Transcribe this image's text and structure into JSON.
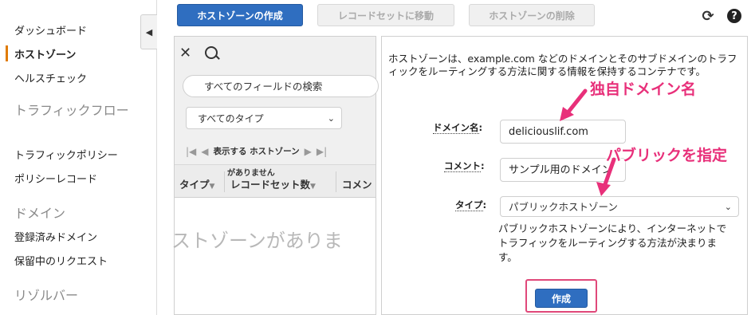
{
  "sidebar": {
    "items": [
      {
        "label": "ダッシュボード",
        "active": false
      },
      {
        "label": "ホストゾーン",
        "active": true
      },
      {
        "label": "ヘルスチェック",
        "active": false
      }
    ],
    "section_traffic": "トラフィックフロー",
    "traffic_items": [
      "トラフィックポリシー",
      "ポリシーレコード"
    ],
    "section_domains": "ドメイン",
    "domain_items": [
      "登録済みドメイン",
      "保留中のリクエスト"
    ],
    "section_resolver": "リゾルバー",
    "collapse_icon": "◀"
  },
  "toolbar": {
    "create_label": "ホストゾーンの作成",
    "goto_records_label": "レコードセットに移動",
    "delete_label": "ホストゾーンの削除",
    "refresh_icon": "⟳",
    "help_icon": "?"
  },
  "list_panel": {
    "close_icon": "✕",
    "search_placeholder": "すべてのフィールドの検索",
    "type_filter": "すべてのタイプ",
    "pager_first": "|◀",
    "pager_prev": "◀",
    "pager_label": "表示する ホストゾーン",
    "pager_next": "▶",
    "pager_last": "▶|",
    "pager_overlay": "がありません",
    "columns": [
      "タイプ",
      "レコードセット数",
      "コメン"
    ],
    "empty_text": "ストゾーンがありま"
  },
  "form": {
    "description": "ホストゾーンは、example.com などのドメインとそのサブドメインのトラフィックをルーティングする方法に関する情報を保持するコンテナです。",
    "domain_label": "ドメイン名",
    "domain_value": "deliciouslif.com",
    "comment_label": "コメント",
    "comment_value": "サンプル用のドメイン",
    "type_label": "タイプ",
    "type_value": "パブリックホストゾーン",
    "type_description": "パブリックホストゾーンにより、インターネットでトラフィックをルーティングする方法が決まります。",
    "create_button": "作成"
  },
  "annotations": {
    "domain_note": "独自ドメイン名",
    "public_note": "パブリックを指定",
    "color": "#e8307a"
  }
}
